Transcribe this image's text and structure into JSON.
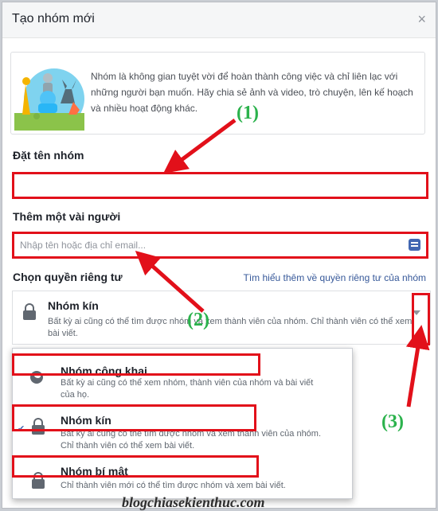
{
  "dialog": {
    "title": "Tạo nhóm mới",
    "close_glyph": "×",
    "intro_text": "Nhóm là không gian tuyệt vời để hoàn thành công việc và chỉ liên lạc với những người bạn muốn. Hãy chia sẻ ảnh và video, trò chuyện, lên kế hoạch và nhiều hoạt động khác."
  },
  "name_section": {
    "label": "Đặt tên nhóm",
    "value": ""
  },
  "people_section": {
    "label": "Thêm một vài người",
    "placeholder": "Nhập tên hoặc địa chỉ email...",
    "value": ""
  },
  "privacy_section": {
    "label": "Chọn quyền riêng tư",
    "learn_more_link": "Tìm hiểu thêm về quyền riêng tư của nhóm",
    "selected": {
      "title": "Nhóm kín",
      "description": "Bất kỳ ai cũng có thể tìm được nhóm và xem thành viên của nhóm. Chỉ thành viên có thể xem bài viết.",
      "icon": "lock-icon"
    },
    "options": [
      {
        "title": "Nhóm công khai",
        "description": "Bất kỳ ai cũng có thể xem nhóm, thành viên của nhóm và bài viết của họ.",
        "icon": "globe-icon",
        "checked": false
      },
      {
        "title": "Nhóm kín",
        "description": "Bất kỳ ai cũng có thể tìm được nhóm và xem thành viên của nhóm. Chỉ thành viên có thể xem bài viết.",
        "icon": "lock-icon",
        "checked": true
      },
      {
        "title": "Nhóm bí mật",
        "description": "Chỉ thành viên mới có thể tìm được nhóm và xem bài viết.",
        "icon": "lock-icon",
        "checked": false
      }
    ]
  },
  "annotations": {
    "step1": "(1)",
    "step2": "(2)",
    "step3": "(3)"
  },
  "watermark": "blogchiasekienthuc.com",
  "colors": {
    "highlight": "#e2101a",
    "annotation": "#2bb24c",
    "link": "#365899",
    "facebook_blue": "#4267b2"
  }
}
